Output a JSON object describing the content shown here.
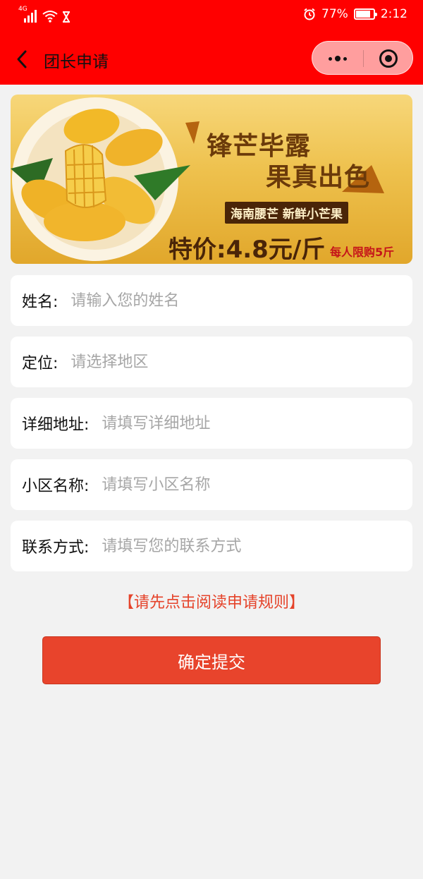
{
  "status_bar": {
    "signal_label": "4G",
    "battery_percent": "77%",
    "battery_level": 0.77,
    "time": "2:12"
  },
  "nav": {
    "title": "团长申请",
    "back_icon": "chevron-left-icon",
    "more_icon": "more-dots-icon",
    "close_icon": "target-circle-icon"
  },
  "banner": {
    "slogan_line1": "锋芒毕露",
    "slogan_line2": "果真出色",
    "tag": "海南腰芒 新鲜小芒果",
    "price": "特价:4.8元/斤",
    "limit": "每人限购5斤"
  },
  "form": {
    "fields": [
      {
        "label": "姓名:",
        "placeholder": "请输入您的姓名"
      },
      {
        "label": "定位:",
        "placeholder": "请选择地区"
      },
      {
        "label": "详细地址:",
        "placeholder": "请填写详细地址"
      },
      {
        "label": "小区名称:",
        "placeholder": "请填写小区名称"
      },
      {
        "label": "联系方式:",
        "placeholder": "请填写您的联系方式"
      }
    ]
  },
  "rules_link": "【请先点击阅读申请规则】",
  "submit_label": "确定提交",
  "colors": {
    "header_bg": "#ff0000",
    "accent": "#e8442c",
    "page_bg": "#f2f2f2"
  }
}
